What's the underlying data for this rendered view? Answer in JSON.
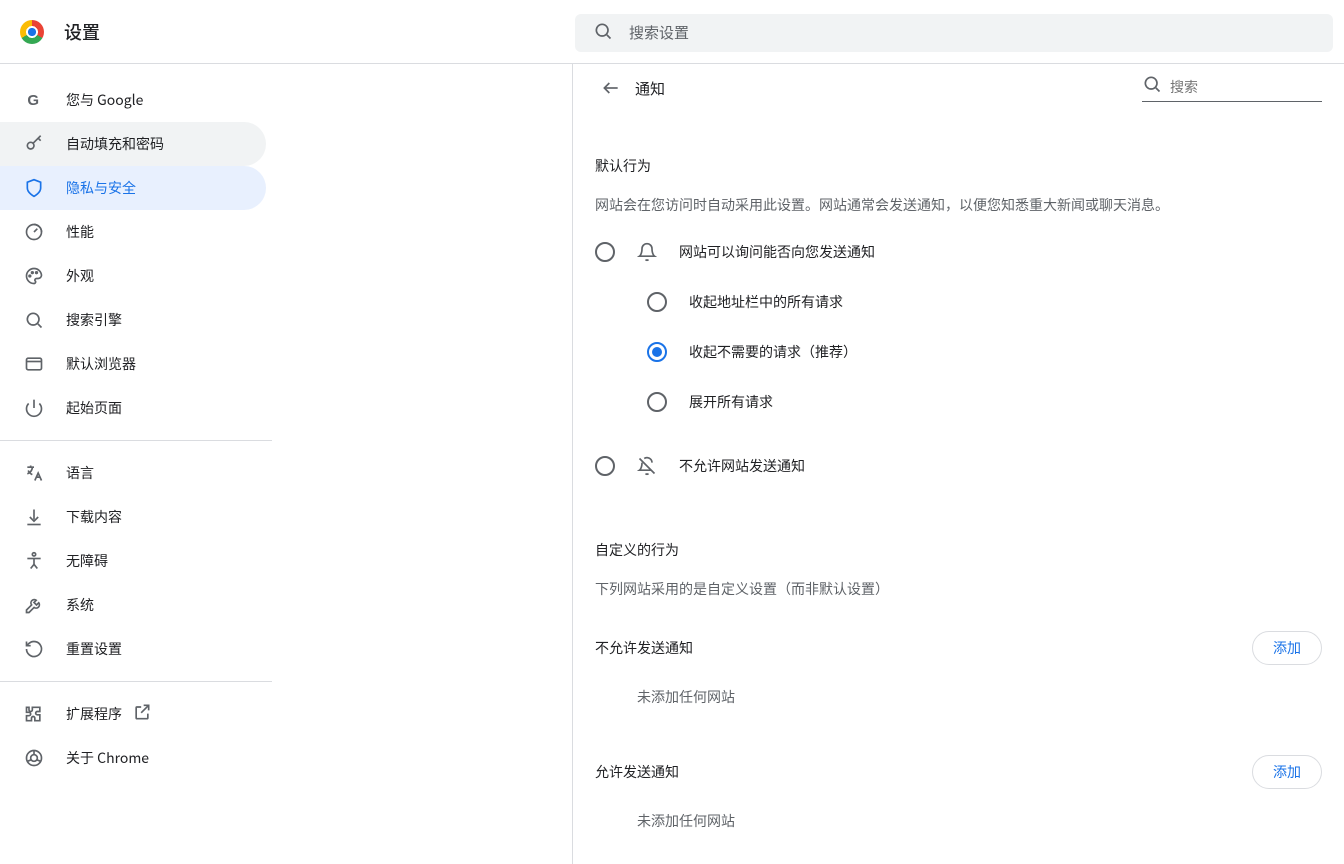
{
  "header": {
    "title": "设置",
    "search_placeholder": "搜索设置"
  },
  "sidebar": {
    "items": [
      {
        "id": "you-and-google",
        "label": "您与 Google",
        "icon": "G"
      },
      {
        "id": "autofill",
        "label": "自动填充和密码",
        "icon": "key",
        "highlight": true
      },
      {
        "id": "privacy-security",
        "label": "隐私与安全",
        "icon": "shield",
        "active": true
      },
      {
        "id": "performance",
        "label": "性能",
        "icon": "speedometer"
      },
      {
        "id": "appearance",
        "label": "外观",
        "icon": "palette"
      },
      {
        "id": "search-engine",
        "label": "搜索引擎",
        "icon": "search"
      },
      {
        "id": "default-browser",
        "label": "默认浏览器",
        "icon": "browser"
      },
      {
        "id": "on-startup",
        "label": "起始页面",
        "icon": "power"
      }
    ],
    "items2": [
      {
        "id": "languages",
        "label": "语言",
        "icon": "translate"
      },
      {
        "id": "downloads",
        "label": "下载内容",
        "icon": "download"
      },
      {
        "id": "accessibility",
        "label": "无障碍",
        "icon": "accessibility"
      },
      {
        "id": "system",
        "label": "系统",
        "icon": "wrench"
      },
      {
        "id": "reset",
        "label": "重置设置",
        "icon": "restore"
      }
    ],
    "items3": [
      {
        "id": "extensions",
        "label": "扩展程序",
        "icon": "puzzle",
        "external": true
      },
      {
        "id": "about",
        "label": "关于 Chrome",
        "icon": "chrome-outline"
      }
    ]
  },
  "main": {
    "page_title": "通知",
    "sub_search_placeholder": "搜索",
    "default_section": {
      "title": "默认行为",
      "desc": "网站会在您访问时自动采用此设置。网站通常会发送通知，以便您知悉重大新闻或聊天消息。"
    },
    "options": {
      "ask": "网站可以询问能否向您发送通知",
      "sub_collapse_all": "收起地址栏中的所有请求",
      "sub_collapse_unneeded": "收起不需要的请求（推荐）",
      "sub_expand_all": "展开所有请求",
      "block": "不允许网站发送通知"
    },
    "custom_section": {
      "title": "自定义的行为",
      "desc": "下列网站采用的是自定义设置（而非默认设置）"
    },
    "block_list": {
      "title": "不允许发送通知",
      "add": "添加",
      "empty": "未添加任何网站"
    },
    "allow_list": {
      "title": "允许发送通知",
      "add": "添加",
      "empty": "未添加任何网站"
    }
  }
}
